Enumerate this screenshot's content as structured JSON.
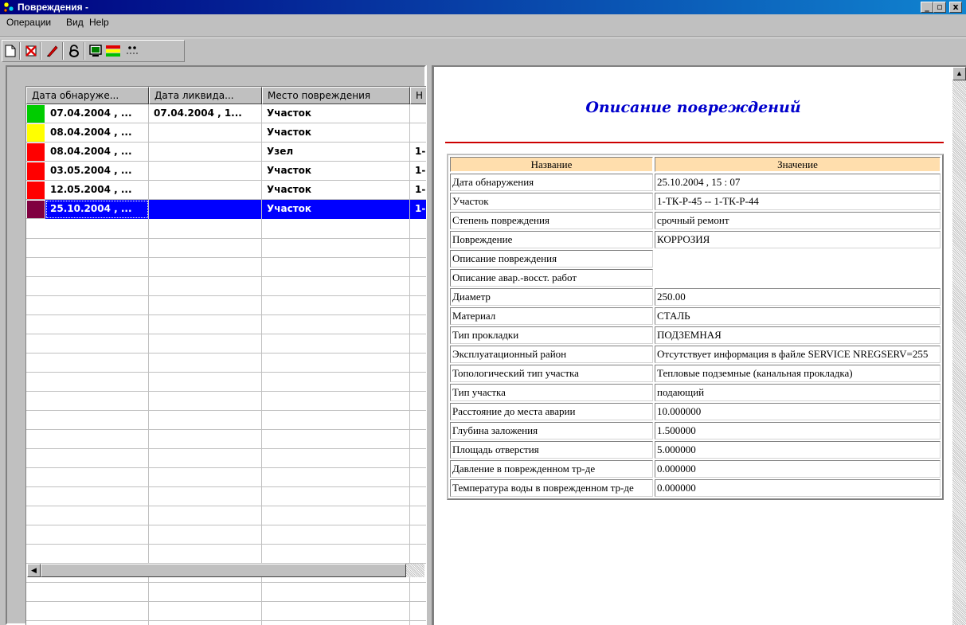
{
  "window": {
    "title": "Повреждения -",
    "min": "_",
    "max": "▫",
    "close": "x"
  },
  "menu": [
    "Операции",
    "Вид",
    "Help"
  ],
  "toolbar": {
    "icons": [
      "new-document-icon",
      "delete-icon",
      "edit-pencil-icon",
      "lock-icon",
      "monitor-icon",
      "status-colors-icon",
      "dots-icon"
    ]
  },
  "grid": {
    "columns": [
      "Дата обнаруже...",
      "Дата ликвида...",
      "Место повреждения",
      "Н"
    ],
    "rows": [
      {
        "color": "#00cc00",
        "cells": [
          "07.04.2004 , ...",
          "07.04.2004 , 1...",
          "Участок",
          ""
        ]
      },
      {
        "color": "#ffff00",
        "cells": [
          "08.04.2004 , ...",
          "",
          "Участок",
          ""
        ]
      },
      {
        "color": "#ff0000",
        "cells": [
          "08.04.2004 , ...",
          "",
          "Узел",
          "1-"
        ]
      },
      {
        "color": "#ff0000",
        "cells": [
          "03.05.2004 , ...",
          "",
          "Участок",
          "1-"
        ]
      },
      {
        "color": "#ff0000",
        "cells": [
          "12.05.2004 , ...",
          "",
          "Участок",
          "1-"
        ]
      },
      {
        "color": "#800040",
        "cells": [
          "25.10.2004 , ...",
          "",
          "Участок",
          "1-"
        ],
        "selected": true
      }
    ]
  },
  "doc": {
    "title": "Описание повреждений",
    "header_name": "Название",
    "header_value": "Значение",
    "props": [
      [
        "Дата обнаружения",
        "25.10.2004 , 15 : 07"
      ],
      [
        "Участок",
        "1-ТК-Р-45 -- 1-ТК-Р-44"
      ],
      [
        "Степень повреждения",
        "срочный ремонт"
      ],
      [
        "Повреждение",
        "КОРРОЗИЯ"
      ],
      [
        "Описание повреждения",
        ""
      ],
      [
        "Описание авар.-восст. работ",
        ""
      ],
      [
        "Диаметр",
        "250.00"
      ],
      [
        "Материал",
        "СТАЛЬ"
      ],
      [
        "Тип прокладки",
        "ПОДЗЕМНАЯ"
      ],
      [
        "Эксплуатационный район",
        "Отсутствует информация в файле SERVICE NREGSERV=255"
      ],
      [
        "Топологический тип участка",
        "Тепловые подземные (канальная прокладка)"
      ],
      [
        "Тип участка",
        "подающий"
      ],
      [
        "Расстояние до места аварии",
        "10.000000"
      ],
      [
        "Глубина заложения",
        "1.500000"
      ],
      [
        "Площадь отверстия",
        "5.000000"
      ],
      [
        "Давление в поврежденном тр-де",
        "0.000000"
      ],
      [
        "Температура воды в поврежденном тр-де",
        "0.000000"
      ]
    ]
  }
}
